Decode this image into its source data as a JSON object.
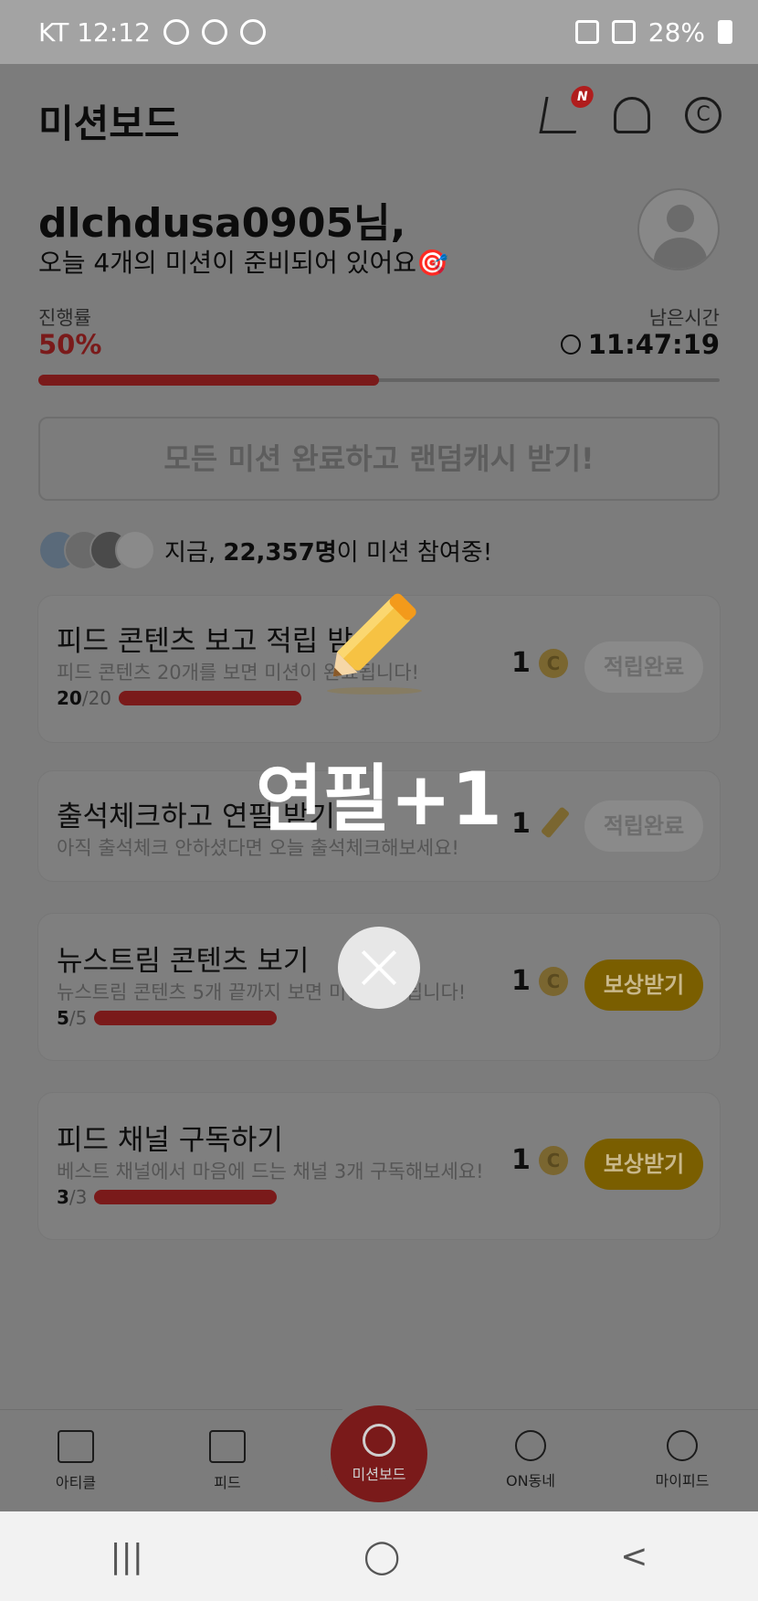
{
  "status_bar": {
    "carrier_time": "KT 12:12",
    "battery": "28%"
  },
  "header": {
    "title": "미션보드",
    "cart_badge": "N",
    "coin_icon": "C"
  },
  "greeting": {
    "name": "dlchdusa0905님,",
    "subtitle": "오늘 4개의 미션이 준비되어 있어요🎯"
  },
  "progress": {
    "label": "진행률",
    "value": "50%",
    "fraction": 0.5,
    "time_label": "남은시간",
    "time_value": "11:47:19"
  },
  "complete_all_button": "모든 미션 완료하고 랜덤캐시 받기!",
  "participants": {
    "prefix": "지금, ",
    "count": "22,357명",
    "suffix": "이 미션 참여중!"
  },
  "missions": [
    {
      "title": "피드 콘텐츠 보고 적립 받",
      "desc": "피드 콘텐츠 20개를 보면 미션이 완료됩니다!",
      "done": "20",
      "total": "/20",
      "reward": "1",
      "reward_icon": "coin-icon",
      "button": "적립완료"
    },
    {
      "title": "출석체크하고 연필 받기",
      "desc": "아직 출석체크 안하셨다면 오늘 출석체크해보세요!",
      "reward": "1",
      "reward_icon": "pencil-icon",
      "button": "적립완료"
    },
    {
      "title": "뉴스트림 콘텐츠 보기",
      "desc": "뉴스트림 콘텐츠 5개 끝까지 보면 미션 완료됩니다!",
      "done": "5",
      "total": "/5",
      "reward": "1",
      "reward_icon": "coin-icon",
      "button": "보상받기"
    },
    {
      "title": "피드 채널 구독하기",
      "desc": "베스트 채널에서 마음에 드는 채널 3개 구독해보세요!",
      "done": "3",
      "total": "/3",
      "reward": "1",
      "reward_icon": "coin-icon",
      "button": "보상받기"
    }
  ],
  "bottom_nav": {
    "article": "아티클",
    "feed": "피드",
    "mission": "미션보드",
    "on_dongne": "ON동네",
    "my_feed": "마이피드"
  },
  "popup": {
    "text": "연필+1"
  },
  "system_nav": {
    "recent": "|||",
    "home": "◯",
    "back": "<"
  },
  "colors": {
    "accent_red": "#c62828",
    "gold": "#f5b400",
    "overlay": "rgba(0,0,0,0.5)"
  }
}
